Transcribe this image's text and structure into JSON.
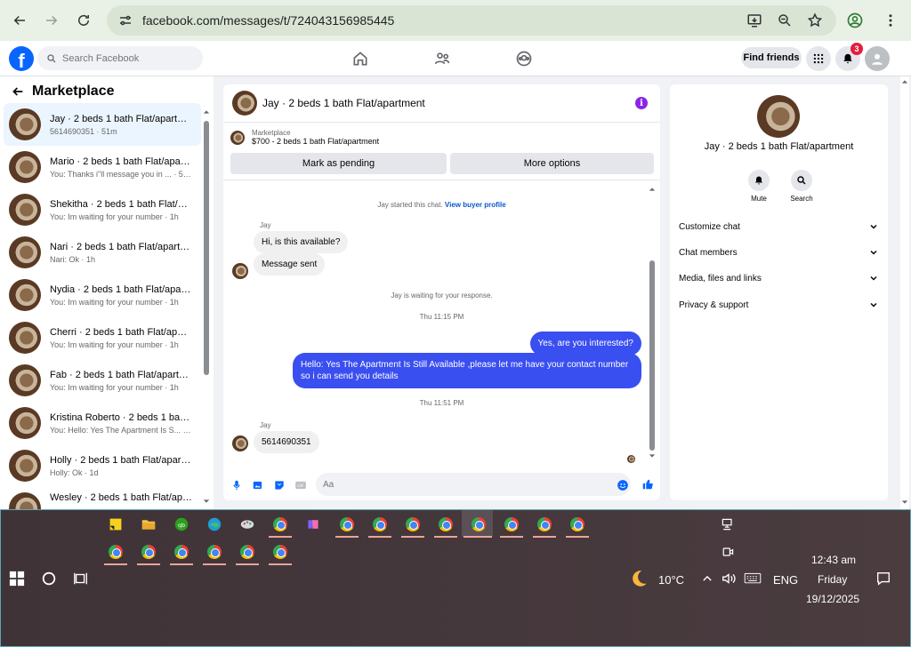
{
  "browser": {
    "url": "facebook.com/messages/t/724043156985445"
  },
  "header": {
    "search_placeholder": "Search Facebook",
    "find_friends": "Find friends",
    "notification_count": "3"
  },
  "sidebar": {
    "title": "Marketplace",
    "conversations": [
      {
        "name": "Jay · 2 beds 1 bath Flat/apartment",
        "sub": "5614690351 · 51m"
      },
      {
        "name": "Mario · 2 beds 1 bath Flat/apartment",
        "sub": "You: Thanks i\"ll message you in ... · 55m"
      },
      {
        "name": "Shekitha · 2 beds 1 bath Flat/apartment",
        "sub": "You: Im waiting for your number · 1h"
      },
      {
        "name": "Nari · 2 beds 1 bath Flat/apartment",
        "sub": "Nari: Ok · 1h"
      },
      {
        "name": "Nydia · 2 beds 1 bath Flat/apartment",
        "sub": "You: Im waiting for your number · 1h"
      },
      {
        "name": "Cherri · 2 beds 1 bath Flat/apartment",
        "sub": "You: Im waiting for your number · 1h"
      },
      {
        "name": "Fab · 2 beds 1 bath Flat/apartment",
        "sub": "You: Im waiting for your number · 1h"
      },
      {
        "name": "Kristina Roberto · 2 beds 1 bath Flat/apartment",
        "sub": "You: Hello: Yes The Apartment Is S... · 1h"
      },
      {
        "name": "Holly · 2 beds 1 bath Flat/apartment",
        "sub": "Holly: Ok · 1d"
      },
      {
        "name": "Wesley · 2 beds 1 bath Flat/apartment",
        "sub": ""
      }
    ]
  },
  "chat": {
    "title": "Jay · 2 beds 1 bath Flat/apartment",
    "listing_category": "Marketplace",
    "listing_price": "$700 - 2 beds 1 bath Flat/apartment",
    "btn_pending": "Mark as pending",
    "btn_more": "More options",
    "started_text": "Jay started this chat.",
    "view_profile": "View buyer profile",
    "sender1": "Jay",
    "msg1": "Hi, is this available?",
    "msg2": "Message sent",
    "waiting": "Jay is waiting for your response.",
    "time1": "Thu 11:15 PM",
    "out1": "Yes, are you interested?",
    "out2": "Hello: Yes The Apartment Is Still Available ,please let me have your contact number so i can send you details",
    "time2": "Thu 11:51 PM",
    "sender2": "Jay",
    "msg3": "5614690351",
    "composer_placeholder": "Aa"
  },
  "right_panel": {
    "name": "Jay · 2 beds 1 bath Flat/apartment",
    "mute": "Mute",
    "search": "Search",
    "rows": [
      "Customize chat",
      "Chat members",
      "Media, files and links",
      "Privacy & support"
    ]
  },
  "taskbar": {
    "temperature": "10°C",
    "language": "ENG",
    "time": "12:43 am",
    "day": "Friday",
    "date": "19/12/2025"
  }
}
